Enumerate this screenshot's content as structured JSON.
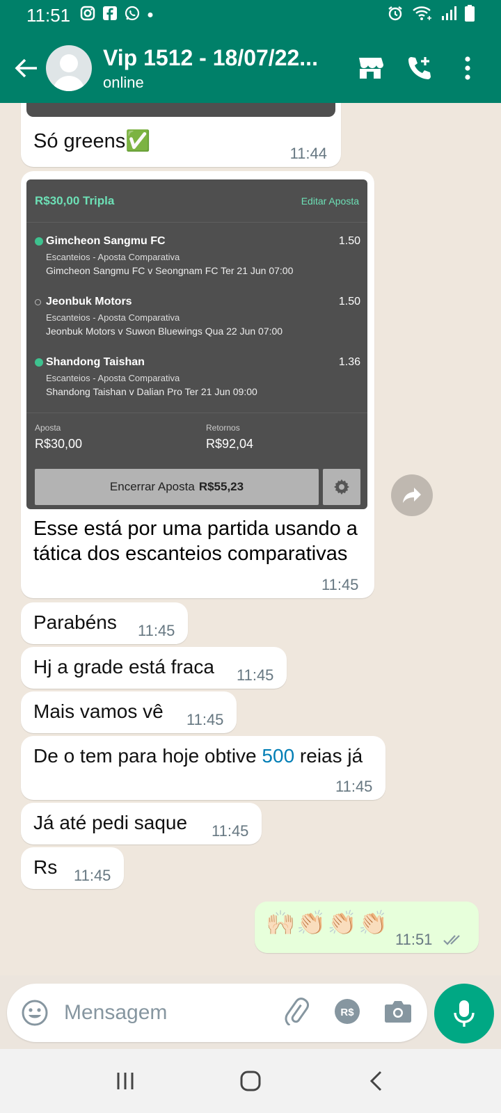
{
  "status": {
    "time": "11:51",
    "icons": [
      "instagram-icon",
      "facebook-icon",
      "whatsapp-icon",
      "dot-icon"
    ],
    "right_icons": [
      "alarm-icon",
      "wifi-icon",
      "signal-icon",
      "battery-icon"
    ]
  },
  "header": {
    "title": "Vip 1512 - 18/07/22...",
    "subtitle": "online"
  },
  "messages": [
    {
      "text": "Só greens✅",
      "time": "11:44"
    },
    {
      "text": "Esse está por uma partida usando a tática dos escanteios comparativas",
      "time": "11:45"
    },
    {
      "text": "Parabéns",
      "time": "11:45"
    },
    {
      "text": "Hj a grade está fraca",
      "time": "11:45"
    },
    {
      "text": "Mais vamos vê",
      "time": "11:45"
    },
    {
      "text_a": "De o tem para hoje obtive ",
      "text_num": "500",
      "text_b": " reias já",
      "time": "11:45"
    },
    {
      "text": "Já até pedi saque",
      "time": "11:45"
    },
    {
      "text": "Rs",
      "time": "11:45"
    },
    {
      "text": "🙌🏻👏🏻👏🏻👏🏻",
      "time": "11:51"
    }
  ],
  "betslip": {
    "title": "R$30,00 Tripla",
    "edit_label": "Editar Aposta",
    "legs": [
      {
        "name": "Gimcheon Sangmu FC",
        "odds": "1.50",
        "market": "Escanteios - Aposta Comparativa",
        "match": "Gimcheon Sangmu FC v Seongnam FC  Ter 21 Jun 07:00",
        "status": "won"
      },
      {
        "name": "Jeonbuk Motors",
        "odds": "1.50",
        "market": "Escanteios - Aposta Comparativa",
        "match": "Jeonbuk Motors v Suwon Bluewings  Qua 22 Jun 07:00",
        "status": "open"
      },
      {
        "name": "Shandong Taishan",
        "odds": "1.36",
        "market": "Escanteios - Aposta Comparativa",
        "match": "Shandong Taishan v Dalian Pro  Ter 21 Jun 09:00",
        "status": "won"
      }
    ],
    "stake_label": "Aposta",
    "stake_value": "R$30,00",
    "returns_label": "Retornos",
    "returns_value": "R$92,04",
    "cashout_label": "Encerrar Aposta",
    "cashout_value": "R$55,23"
  },
  "composer": {
    "placeholder": "Mensagem"
  },
  "colors": {
    "header": "#008069",
    "accent": "#00a884",
    "outgoing_bubble": "#e7ffdb",
    "link": "#027eb5",
    "bet_green": "#6de0b6"
  }
}
